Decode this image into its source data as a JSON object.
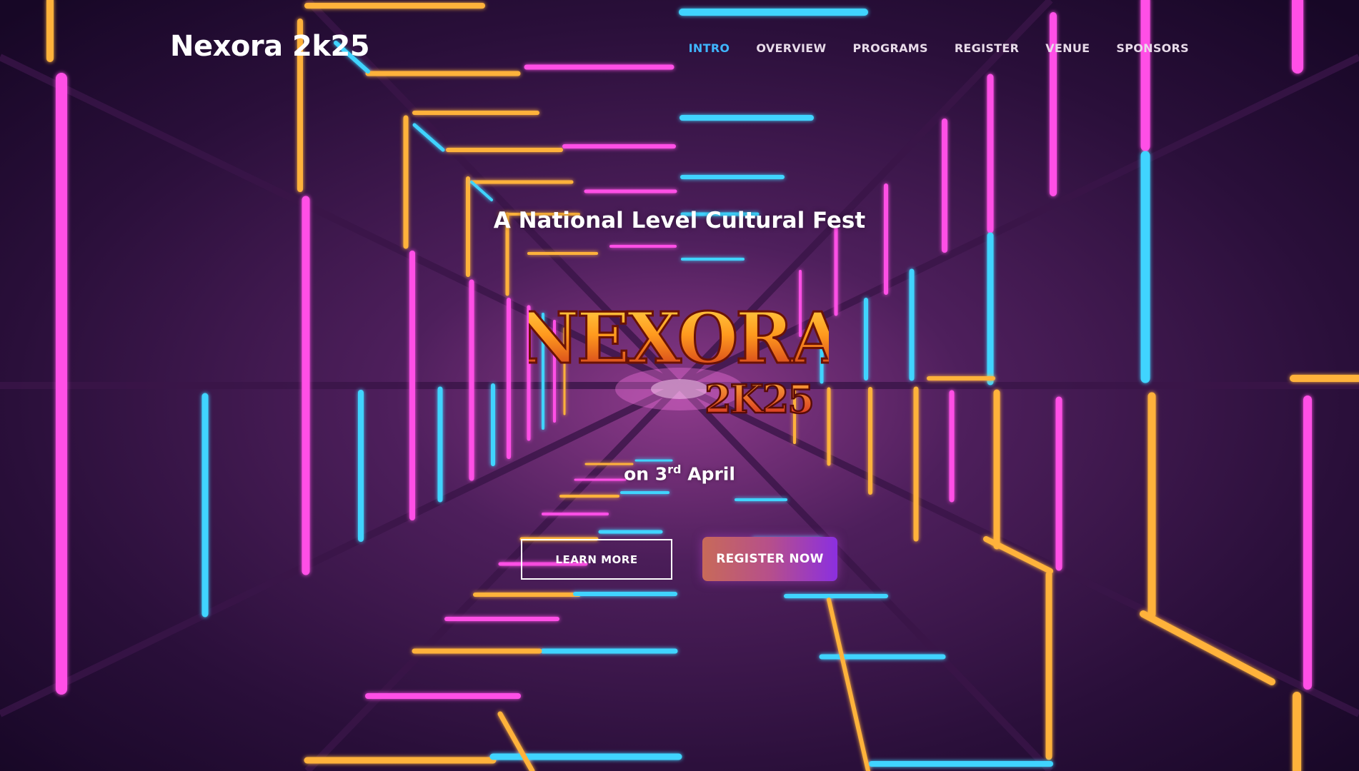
{
  "header": {
    "brand": "Nexora 2k25",
    "nav": [
      {
        "label": "INTRO",
        "active": true
      },
      {
        "label": "OVERVIEW",
        "active": false
      },
      {
        "label": "PROGRAMS",
        "active": false
      },
      {
        "label": "REGISTER",
        "active": false
      },
      {
        "label": "VENUE",
        "active": false
      },
      {
        "label": "SPONSORS",
        "active": false
      }
    ]
  },
  "hero": {
    "subtitle": "A National Level Cultural Fest",
    "logo": {
      "word": "NEXORA",
      "year": "2K25"
    },
    "date_prefix": "on 3",
    "date_sup": "rd",
    "date_suffix": " April",
    "learn_more_label": "LEARN MORE",
    "register_label": "REGISTER NOW"
  },
  "colors": {
    "background": "#1a0826",
    "accent_active_nav": "#3fb6ff",
    "neon_pink": "#ff4fe6",
    "neon_cyan": "#3fd4ff",
    "neon_orange": "#ffb23a",
    "register_gradient_start": "#c86a59",
    "register_gradient_end": "#8b2fe0"
  }
}
